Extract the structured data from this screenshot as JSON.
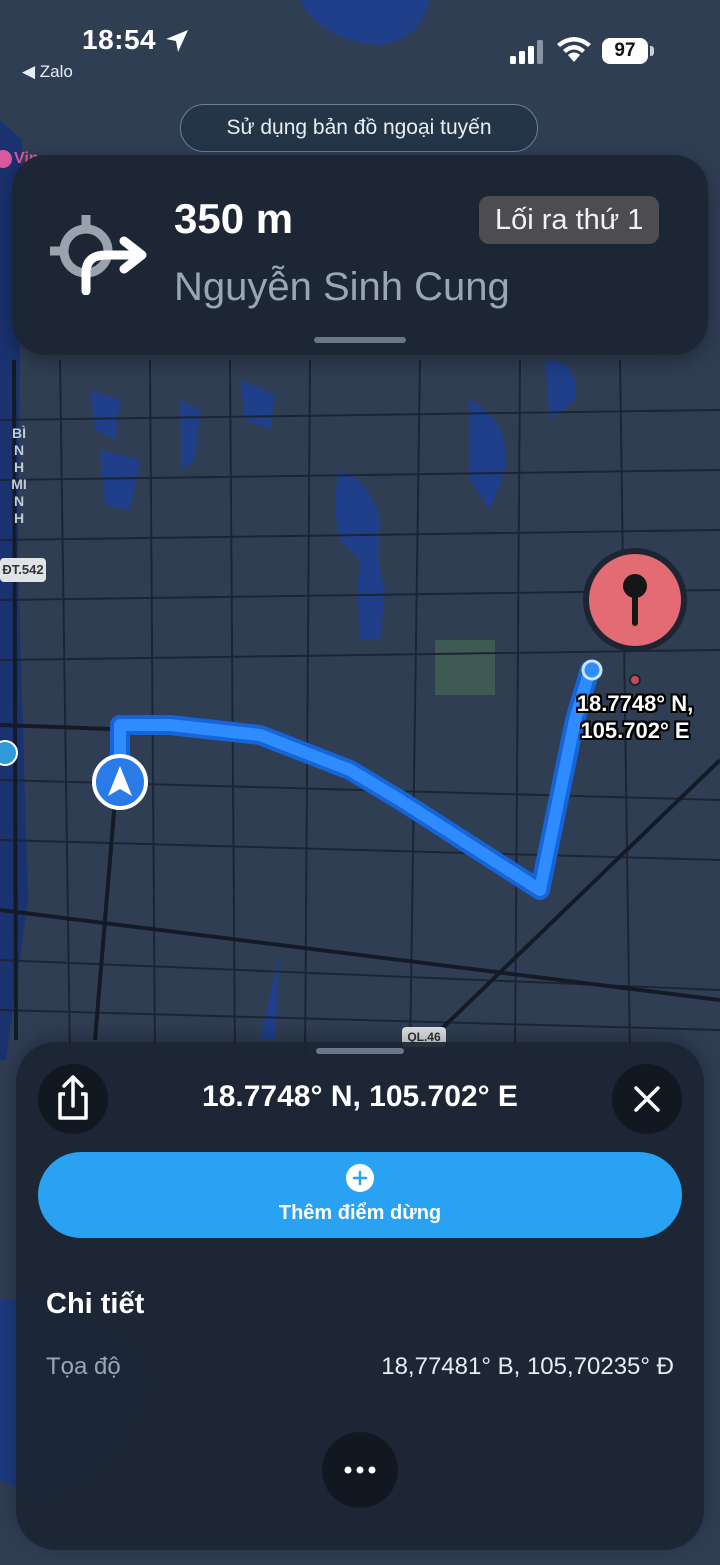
{
  "status_bar": {
    "time": "18:54",
    "back_app": "◀ Zalo",
    "battery": "97"
  },
  "offline_notice": "Sử dụng bản đồ ngoại tuyến",
  "navigation": {
    "distance": "350 m",
    "street": "Nguyễn Sinh Cung",
    "exit_badge": "Lối ra thứ 1",
    "maneuver_icon": "roundabout-right-icon"
  },
  "map": {
    "area_label": "BÌNH MINH",
    "road_badge": "ĐT.542",
    "road_badge_2": "QL.46",
    "poi_label": "Vin",
    "pin_label_line1": "18.7748° N,",
    "pin_label_line2": "105.702° E",
    "route_color": "#2f8cff",
    "pin_color": "#e36b74"
  },
  "sheet": {
    "title": "18.7748° N, 105.702° E",
    "add_stop_label": "Thêm điểm dừng",
    "details_heading": "Chi tiết",
    "coordinates_label": "Tọa độ",
    "coordinates_value": "18,77481° B, 105,70235° Đ",
    "accent": "#2aa2f4"
  }
}
